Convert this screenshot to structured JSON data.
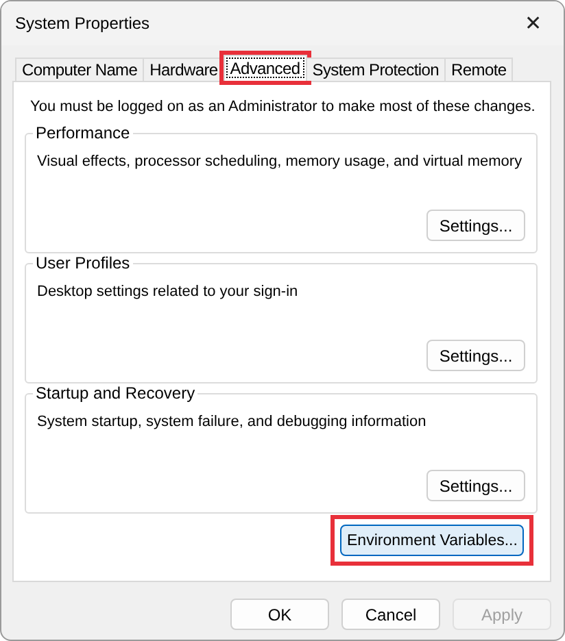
{
  "window": {
    "title": "System Properties",
    "close": "✕"
  },
  "tabs": [
    {
      "label": "Computer Name",
      "selected": false,
      "highlighted": false
    },
    {
      "label": "Hardware",
      "selected": false,
      "highlighted": false
    },
    {
      "label": "Advanced",
      "selected": true,
      "highlighted": true
    },
    {
      "label": "System Protection",
      "selected": false,
      "highlighted": false
    },
    {
      "label": "Remote",
      "selected": false,
      "highlighted": false
    }
  ],
  "notice": "You must be logged on as an Administrator to make most of these changes.",
  "groups": [
    {
      "title": "Performance",
      "description": "Visual effects, processor scheduling, memory usage, and virtual memory",
      "button": "Settings..."
    },
    {
      "title": "User Profiles",
      "description": "Desktop settings related to your sign-in",
      "button": "Settings..."
    },
    {
      "title": "Startup and Recovery",
      "description": "System startup, system failure, and debugging information",
      "button": "Settings..."
    }
  ],
  "environment_button": {
    "label": "Environment Variables...",
    "highlighted": true
  },
  "buttons": [
    {
      "label": "OK",
      "disabled": false
    },
    {
      "label": "Cancel",
      "disabled": false
    },
    {
      "label": "Apply",
      "disabled": true
    }
  ]
}
